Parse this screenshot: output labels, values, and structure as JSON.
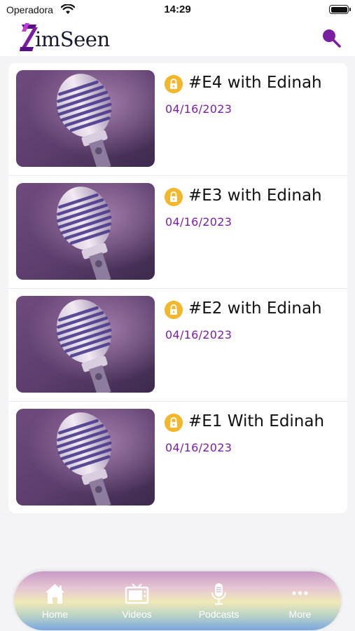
{
  "status_bar": {
    "carrier": "Operadora",
    "time": "14:29"
  },
  "header": {
    "logo_text": "imSeen",
    "logo_letter": "Z",
    "brand_color": "#7b1fa2"
  },
  "episodes": [
    {
      "title": "#E4 with Edinah",
      "date": "04/16/2023",
      "locked": true
    },
    {
      "title": "#E3 with Edinah",
      "date": "04/16/2023",
      "locked": true
    },
    {
      "title": "#E2 with Edinah",
      "date": "04/16/2023",
      "locked": true
    },
    {
      "title": "#E1 With Edinah",
      "date": "04/16/2023",
      "locked": true
    }
  ],
  "tab_bar": {
    "tabs": [
      {
        "label": "Home",
        "icon": "home-icon"
      },
      {
        "label": "Videos",
        "icon": "tv-icon"
      },
      {
        "label": "Podcasts",
        "icon": "microphone-icon"
      },
      {
        "label": "More",
        "icon": "more-icon"
      }
    ]
  },
  "colors": {
    "accent": "#7b1fa2",
    "lock_badge": "#f2b72a"
  }
}
